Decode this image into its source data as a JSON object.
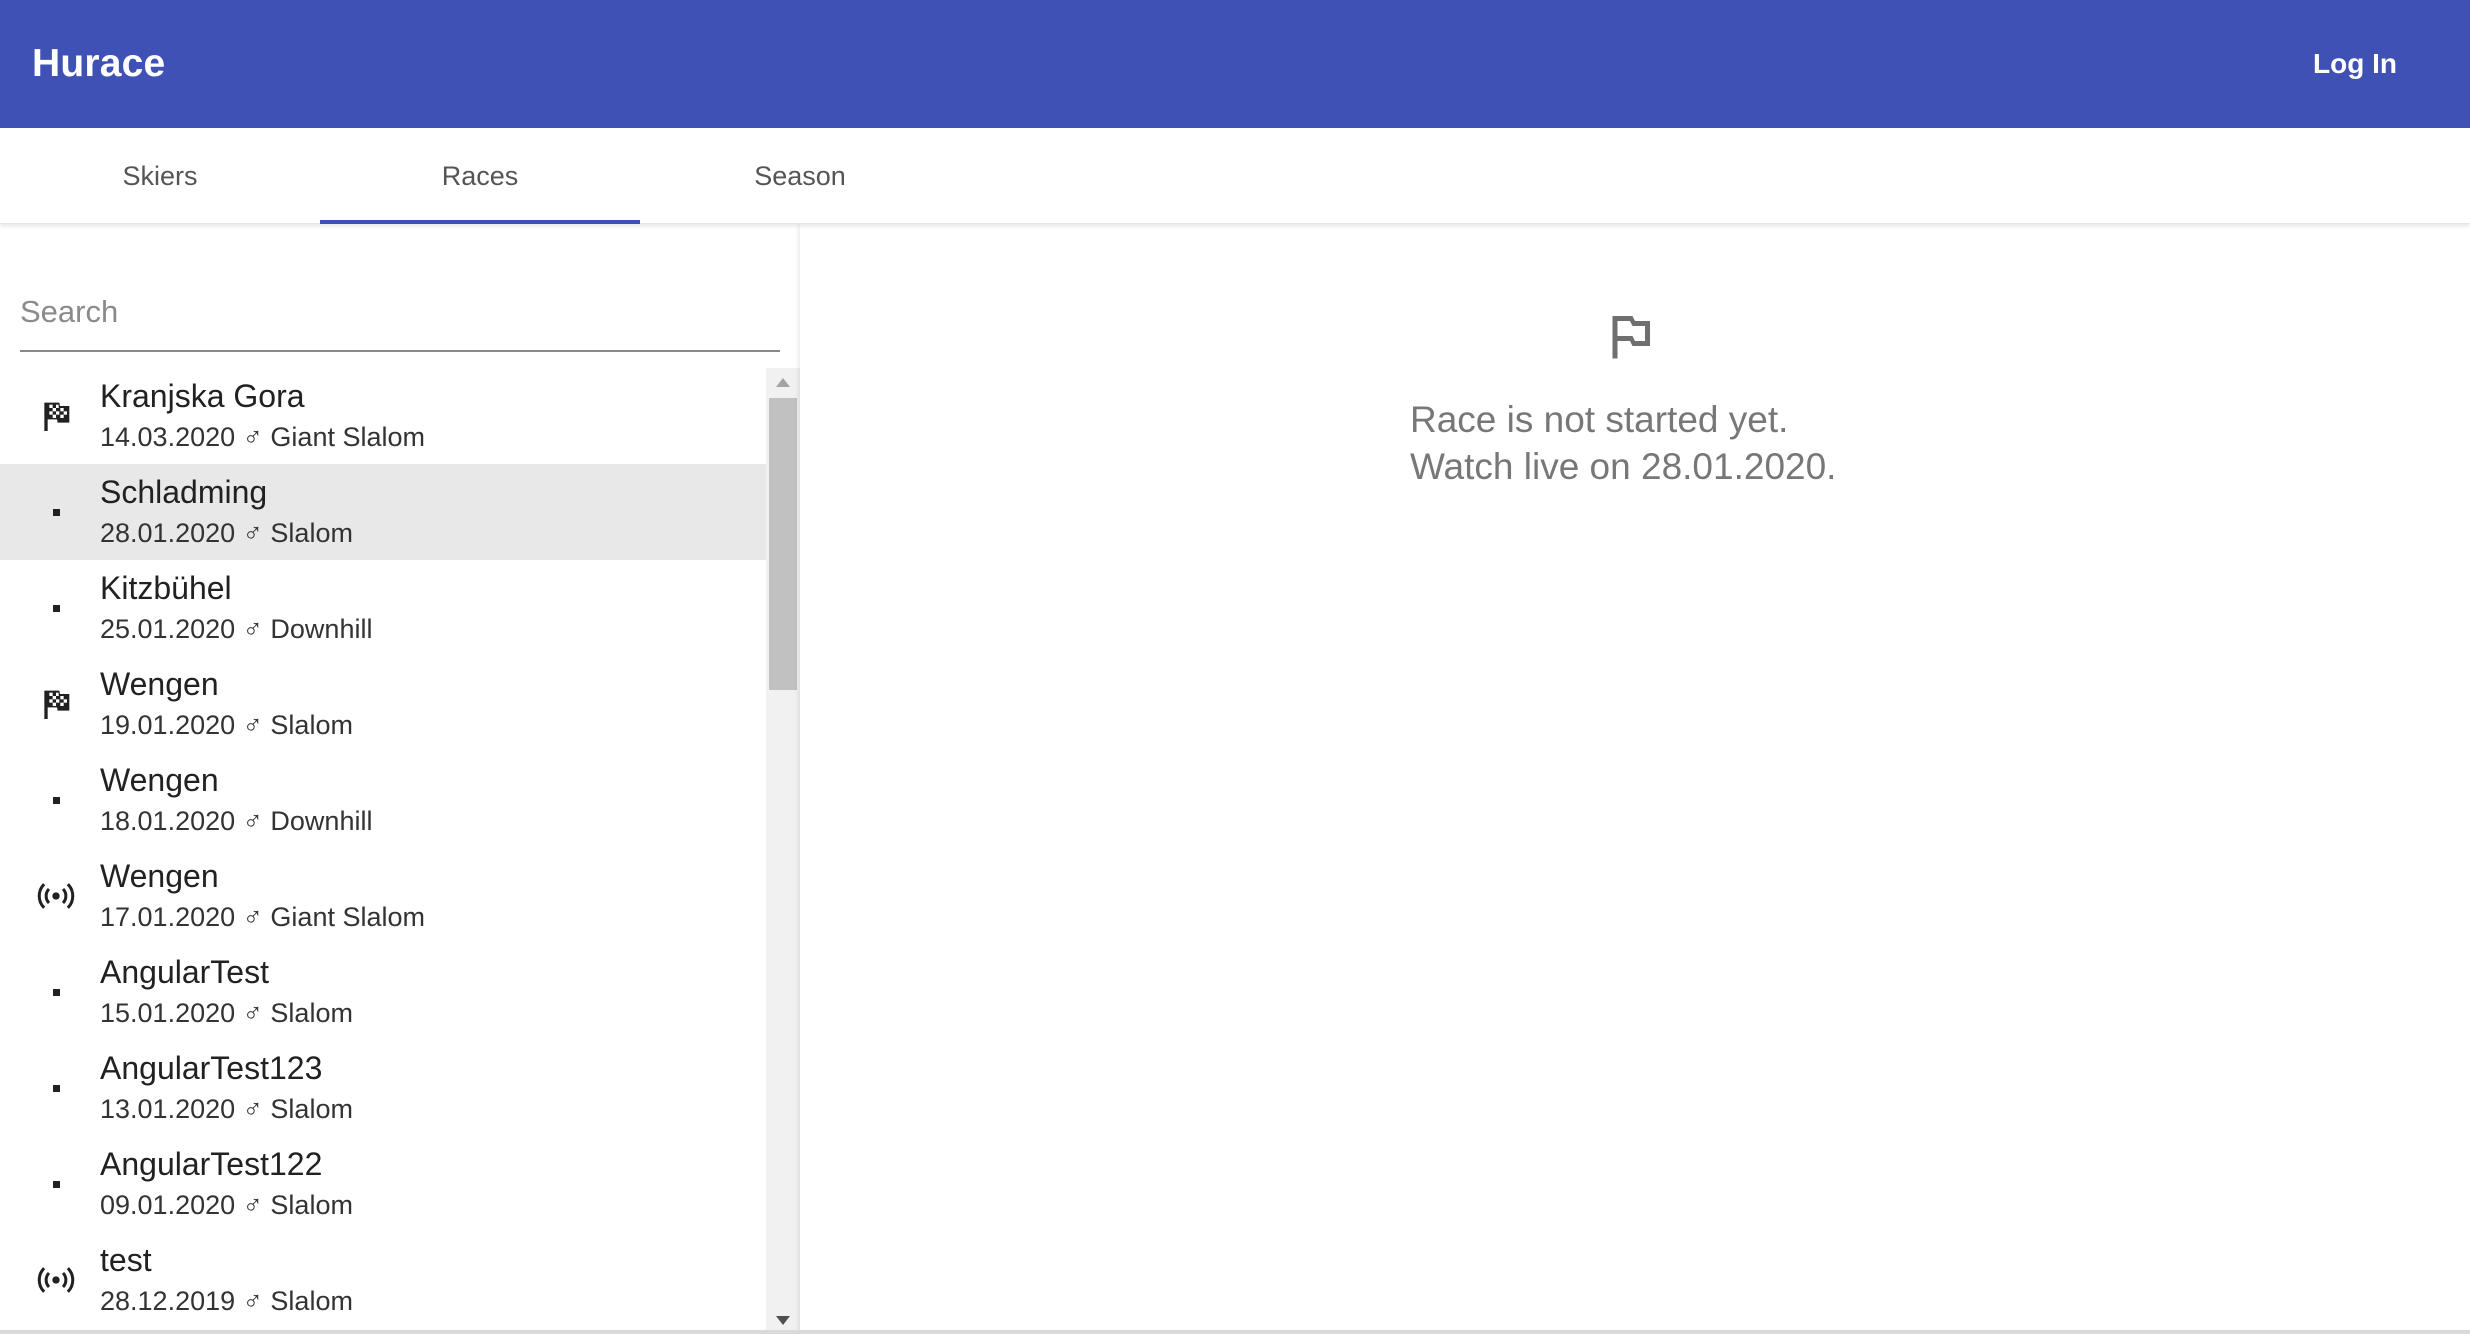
{
  "header": {
    "app_title": "Huracе",
    "login_label": "Log In"
  },
  "tabs": [
    {
      "label": "Skiers",
      "active": false
    },
    {
      "label": "Races",
      "active": true
    },
    {
      "label": "Season",
      "active": false
    }
  ],
  "search": {
    "placeholder": "Search",
    "value": ""
  },
  "races": [
    {
      "name": "Kranjska Gora",
      "date": "14.03.2020",
      "gender_symbol": "♂",
      "discipline": "Giant Slalom",
      "status_icon": "checkered-flag-icon",
      "selected": false
    },
    {
      "name": "Schladming",
      "date": "28.01.2020",
      "gender_symbol": "♂",
      "discipline": "Slalom",
      "status_icon": "dot-icon",
      "selected": true
    },
    {
      "name": "Kitzbühel",
      "date": "25.01.2020",
      "gender_symbol": "♂",
      "discipline": "Downhill",
      "status_icon": "dot-icon",
      "selected": false
    },
    {
      "name": "Wengen",
      "date": "19.01.2020",
      "gender_symbol": "♂",
      "discipline": "Slalom",
      "status_icon": "checkered-flag-icon",
      "selected": false
    },
    {
      "name": "Wengen",
      "date": "18.01.2020",
      "gender_symbol": "♂",
      "discipline": "Downhill",
      "status_icon": "dot-icon",
      "selected": false
    },
    {
      "name": "Wengen",
      "date": "17.01.2020",
      "gender_symbol": "♂",
      "discipline": "Giant Slalom",
      "status_icon": "live-broadcast-icon",
      "selected": false
    },
    {
      "name": "AngularTest",
      "date": "15.01.2020",
      "gender_symbol": "♂",
      "discipline": "Slalom",
      "status_icon": "dot-icon",
      "selected": false
    },
    {
      "name": "AngularTest123",
      "date": "13.01.2020",
      "gender_symbol": "♂",
      "discipline": "Slalom",
      "status_icon": "dot-icon",
      "selected": false
    },
    {
      "name": "AngularTest122",
      "date": "09.01.2020",
      "gender_symbol": "♂",
      "discipline": "Slalom",
      "status_icon": "dot-icon",
      "selected": false
    },
    {
      "name": "test",
      "date": "28.12.2019",
      "gender_symbol": "♂",
      "discipline": "Slalom",
      "status_icon": "live-broadcast-icon",
      "selected": false
    }
  ],
  "main": {
    "icon": "outlined-flag-icon",
    "status_line_1": "Race is not started yet.",
    "status_line_2": "Watch live on 28.01.2020."
  },
  "colors": {
    "primary": "#3f51b5",
    "selected_row": "#e8e8e8",
    "muted_text": "#777777"
  }
}
